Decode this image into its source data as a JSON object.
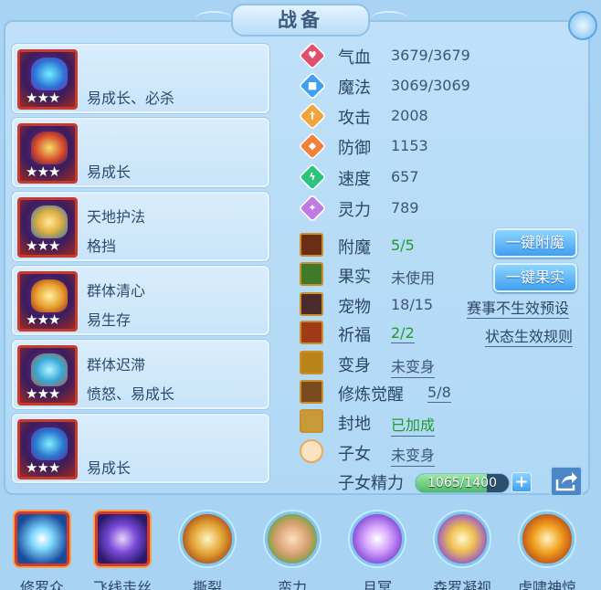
{
  "title": "战备",
  "cards": [
    {
      "line1": "",
      "line2": "易成长、必杀",
      "stars": "★★★"
    },
    {
      "line1": "",
      "line2": "易成长",
      "stars": "★★★"
    },
    {
      "line1": "天地护法",
      "line2": "格挡",
      "stars": "★★★"
    },
    {
      "line1": "群体清心",
      "line2": "易生存",
      "stars": "★★★"
    },
    {
      "line1": "群体迟滞",
      "line2": "愤怒、易成长",
      "stars": "★★★"
    },
    {
      "line1": "",
      "line2": "易成长",
      "stars": "★★★"
    }
  ],
  "stats": [
    {
      "label": "气血",
      "value": "3679/3679",
      "icon": "heart-icon",
      "color": "#e0506a"
    },
    {
      "label": "魔法",
      "value": "3069/3069",
      "icon": "mana-icon",
      "color": "#3f9ff0"
    },
    {
      "label": "攻击",
      "value": "2008",
      "icon": "sword-icon",
      "color": "#f0a43a"
    },
    {
      "label": "防御",
      "value": "1153",
      "icon": "shield-icon",
      "color": "#f0803a"
    },
    {
      "label": "速度",
      "value": "657",
      "icon": "speed-icon",
      "color": "#2cc47c"
    },
    {
      "label": "灵力",
      "value": "789",
      "icon": "spirit-icon",
      "color": "#c07ae0"
    }
  ],
  "rows": {
    "enchant": {
      "label": "附魔",
      "value": "5/5"
    },
    "fruit": {
      "label": "果实",
      "value": "未使用"
    },
    "pet": {
      "label": "宠物",
      "value": "18/15"
    },
    "blessing": {
      "label": "祈福",
      "value": "2/2"
    },
    "transform": {
      "label": "变身",
      "value": "未变身"
    },
    "awaken": {
      "label": "修炼觉醒",
      "value": "5/8"
    },
    "seal": {
      "label": "封地",
      "value": "已加成"
    },
    "children": {
      "label": "子女",
      "value": "未变身"
    }
  },
  "buttons": {
    "enchant": "一键附魔",
    "fruit": "一键果实"
  },
  "links": {
    "preset": "赛事不生效预设",
    "rules": "状态生效规则"
  },
  "energy": {
    "label": "子女精力",
    "text": "1065/1400",
    "fraction": 0.76,
    "plus": "+"
  },
  "skills": [
    "修罗众",
    "飞线走丝",
    "撕裂",
    "蛮力",
    "月冥",
    "森罗凝视",
    "虎啸神惊"
  ]
}
